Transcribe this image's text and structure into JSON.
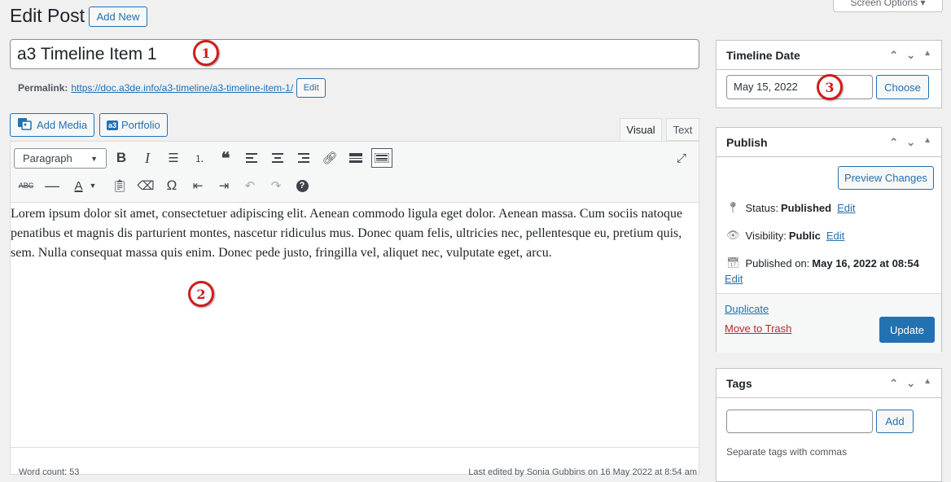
{
  "header": {
    "title": "Edit Post",
    "add_new": "Add New",
    "screen_options": "Screen Options ▾"
  },
  "post": {
    "title": "a3 Timeline Item 1",
    "permalink_label": "Permalink:",
    "permalink_url": "https://doc.a3de.info/a3-timeline/a3-timeline-item-1/",
    "permalink_edit": "Edit"
  },
  "media": {
    "add_media": "Add Media",
    "portfolio": "Portfolio"
  },
  "editor": {
    "tabs": [
      "Visual",
      "Text"
    ],
    "format_select": "Paragraph",
    "content": "Lorem ipsum dolor sit amet, consectetuer adipiscing elit. Aenean commodo ligula eget dolor. Aenean massa. Cum sociis natoque penatibus et magnis dis parturient montes, nascetur ridiculus mus. Donec quam felis, ultricies nec, pellentesque eu, pretium quis, sem. Nulla consequat massa quis enim. Donec pede justo, fringilla vel, aliquet nec, vulputate eget, arcu.",
    "word_count": "Word count: 53",
    "last_edited": "Last edited by Sonia Gubbins on 16 May 2022 at 8:54 am"
  },
  "timeline_date": {
    "title": "Timeline Date",
    "value": "May 15, 2022",
    "choose": "Choose"
  },
  "publish": {
    "title": "Publish",
    "preview": "Preview Changes",
    "status_label": "Status:",
    "status_value": "Published",
    "status_edit": "Edit",
    "visibility_label": "Visibility:",
    "visibility_value": "Public",
    "visibility_edit": "Edit",
    "published_label": "Published on:",
    "published_value": "May 16, 2022 at 08:54",
    "published_edit": "Edit",
    "duplicate": "Duplicate",
    "trash": "Move to Trash",
    "update": "Update"
  },
  "tags": {
    "title": "Tags",
    "add": "Add",
    "hint": "Separate tags with commas",
    "placeholder": ""
  },
  "markers": [
    "1",
    "2",
    "3"
  ],
  "colors": {
    "accent": "#2271b1",
    "marker": "#d21b1b",
    "trash": "#b32d2e"
  }
}
